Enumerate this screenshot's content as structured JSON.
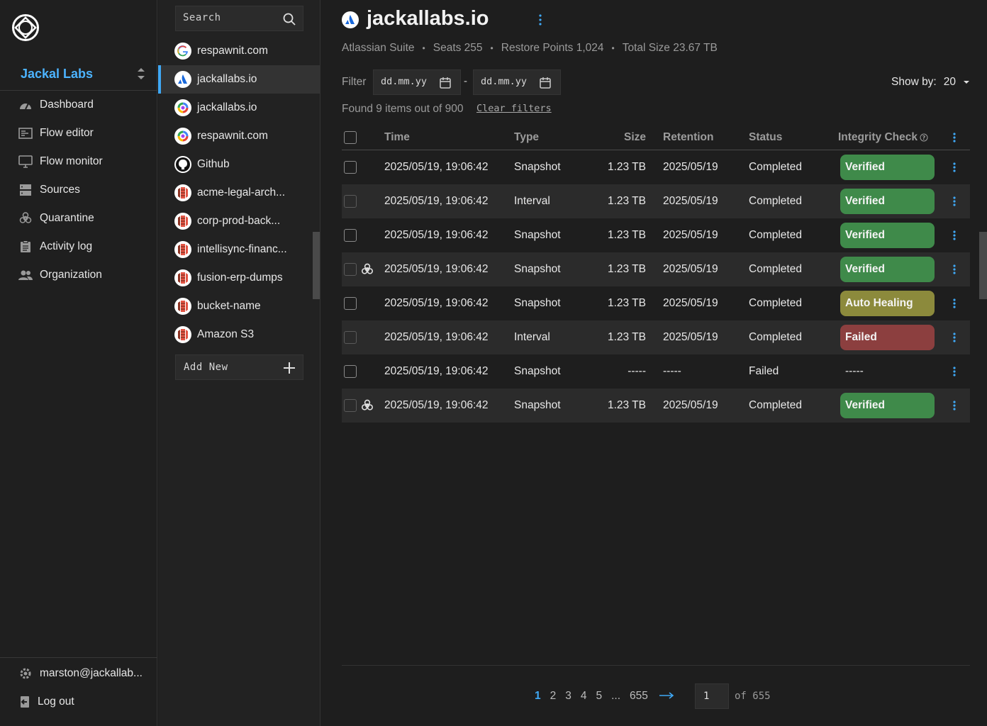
{
  "nav": {
    "org_name": "Jackal Labs",
    "items": [
      {
        "label": "Dashboard",
        "icon": "dashboard-gauge-icon"
      },
      {
        "label": "Flow editor",
        "icon": "flow-editor-icon"
      },
      {
        "label": "Flow monitor",
        "icon": "monitor-icon"
      },
      {
        "label": "Sources",
        "icon": "server-icon"
      },
      {
        "label": "Quarantine",
        "icon": "biohazard-icon"
      },
      {
        "label": "Activity log",
        "icon": "clipboard-icon"
      },
      {
        "label": "Organization",
        "icon": "people-icon"
      }
    ],
    "user_email": "marston@jackallab...",
    "logout_label": "Log out"
  },
  "sources": {
    "search_placeholder": "Search",
    "items": [
      {
        "label": "respawnit.com",
        "icon": "google-icon"
      },
      {
        "label": "jackallabs.io",
        "icon": "atlassian-icon",
        "active": true
      },
      {
        "label": "jackallabs.io",
        "icon": "google-workspace-icon"
      },
      {
        "label": "respawnit.com",
        "icon": "google-workspace-icon"
      },
      {
        "label": "Github",
        "icon": "github-icon"
      },
      {
        "label": "acme-legal-arch...",
        "icon": "aws-s3-icon"
      },
      {
        "label": "corp-prod-back...",
        "icon": "aws-s3-icon"
      },
      {
        "label": "intellisync-financ...",
        "icon": "aws-s3-icon"
      },
      {
        "label": "fusion-erp-dumps",
        "icon": "aws-s3-icon"
      },
      {
        "label": "bucket-name",
        "icon": "aws-s3-icon"
      },
      {
        "label": "Amazon S3",
        "icon": "aws-s3-icon"
      }
    ],
    "add_new_label": "Add New"
  },
  "header": {
    "title": "jackallabs.io",
    "suite": "Atlassian Suite",
    "seats": "Seats 255",
    "restore_points": "Restore Points 1,024",
    "total_size": "Total Size 23.67 TB"
  },
  "filter": {
    "label": "Filter",
    "from_placeholder": "dd.mm.yy",
    "to_placeholder": "dd.mm.yy",
    "separator": "-",
    "show_by_label": "Show by:",
    "show_by_value": "20",
    "found_text": "Found 9 items out of 900",
    "clear_label": "Clear filters"
  },
  "table": {
    "columns": {
      "time": "Time",
      "type": "Type",
      "size": "Size",
      "retention": "Retention",
      "status": "Status",
      "integrity": "Integrity Check"
    },
    "rows": [
      {
        "time": "2025/05/19, 19:06:42",
        "type": "Snapshot",
        "size": "1.23 TB",
        "retention": "2025/05/19",
        "status": "Completed",
        "integrity": "Verified",
        "integrity_kind": "verified",
        "quarantine": false
      },
      {
        "time": "2025/05/19, 19:06:42",
        "type": "Interval",
        "size": "1.23 TB",
        "retention": "2025/05/19",
        "status": "Completed",
        "integrity": "Verified",
        "integrity_kind": "verified",
        "quarantine": false
      },
      {
        "time": "2025/05/19, 19:06:42",
        "type": "Snapshot",
        "size": "1.23 TB",
        "retention": "2025/05/19",
        "status": "Completed",
        "integrity": "Verified",
        "integrity_kind": "verified",
        "quarantine": false
      },
      {
        "time": "2025/05/19, 19:06:42",
        "type": "Snapshot",
        "size": "1.23 TB",
        "retention": "2025/05/19",
        "status": "Completed",
        "integrity": "Verified",
        "integrity_kind": "verified",
        "quarantine": true
      },
      {
        "time": "2025/05/19, 19:06:42",
        "type": "Snapshot",
        "size": "1.23 TB",
        "retention": "2025/05/19",
        "status": "Completed",
        "integrity": "Auto Healing",
        "integrity_kind": "healing",
        "quarantine": false
      },
      {
        "time": "2025/05/19, 19:06:42",
        "type": "Interval",
        "size": "1.23 TB",
        "retention": "2025/05/19",
        "status": "Completed",
        "integrity": "Failed",
        "integrity_kind": "failed",
        "quarantine": false
      },
      {
        "time": "2025/05/19, 19:06:42",
        "type": "Snapshot",
        "size": "-----",
        "retention": "-----",
        "status": "Failed",
        "integrity": "-----",
        "integrity_kind": "none",
        "quarantine": false
      },
      {
        "time": "2025/05/19, 19:06:42",
        "type": "Snapshot",
        "size": "1.23 TB",
        "retention": "2025/05/19",
        "status": "Completed",
        "integrity": "Verified",
        "integrity_kind": "verified",
        "quarantine": true
      }
    ]
  },
  "pagination": {
    "pages": [
      "1",
      "2",
      "3",
      "4",
      "5",
      "...",
      "655"
    ],
    "current": "1",
    "input_value": "1",
    "of_text": "of 655"
  },
  "colors": {
    "accent": "#3fa8f5",
    "verified": "#3f8a4a",
    "healing": "#8c8a3c",
    "failed": "#8c3f3f"
  }
}
